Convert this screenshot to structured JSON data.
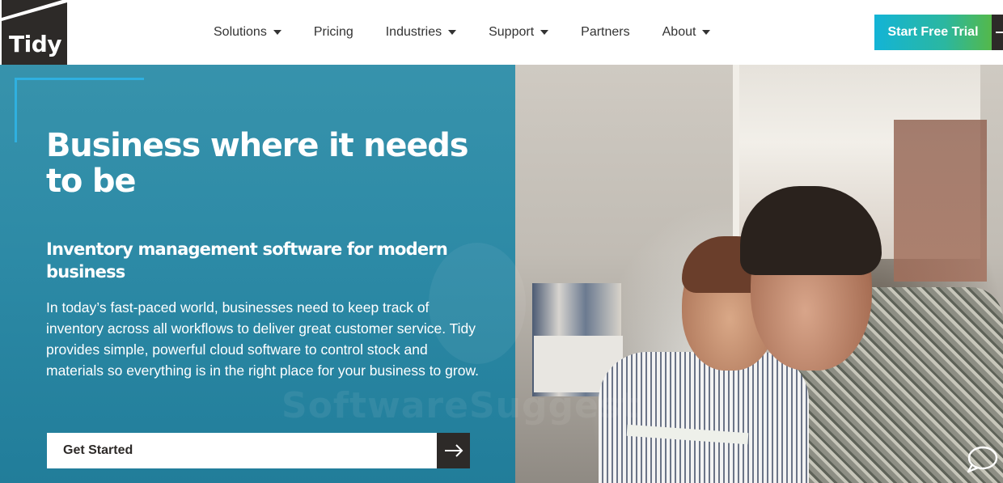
{
  "brand": {
    "logo_text": "Tidy"
  },
  "nav": {
    "items": [
      {
        "label": "Solutions",
        "has_dropdown": true
      },
      {
        "label": "Pricing",
        "has_dropdown": false
      },
      {
        "label": "Industries",
        "has_dropdown": true
      },
      {
        "label": "Support",
        "has_dropdown": true
      },
      {
        "label": "Partners",
        "has_dropdown": false
      },
      {
        "label": "About",
        "has_dropdown": true
      }
    ]
  },
  "header": {
    "trial_label": "Start Free Trial"
  },
  "hero": {
    "title": "Business where it needs to be",
    "subtitle": "Inventory management software for modern business",
    "body": "In today’s fast-paced world, businesses need to keep track of inventory across all workflows to deliver great customer service. Tidy provides simple, powerful cloud software to control stock and materials so everything is in the right place for your business to grow.",
    "cta_label": "Get Started",
    "watermark": "SoftwareSuggest"
  },
  "icons": {
    "dropdown": "caret-down-icon",
    "cta": "arrow-right-icon",
    "chat": "chat-bubble-icon"
  },
  "colors": {
    "overlay": "#228ba9",
    "accent": "#2fb0e0",
    "dark": "#2d2a28",
    "trial_gradient_start": "#13b4d6",
    "trial_gradient_end": "#54b84a"
  }
}
